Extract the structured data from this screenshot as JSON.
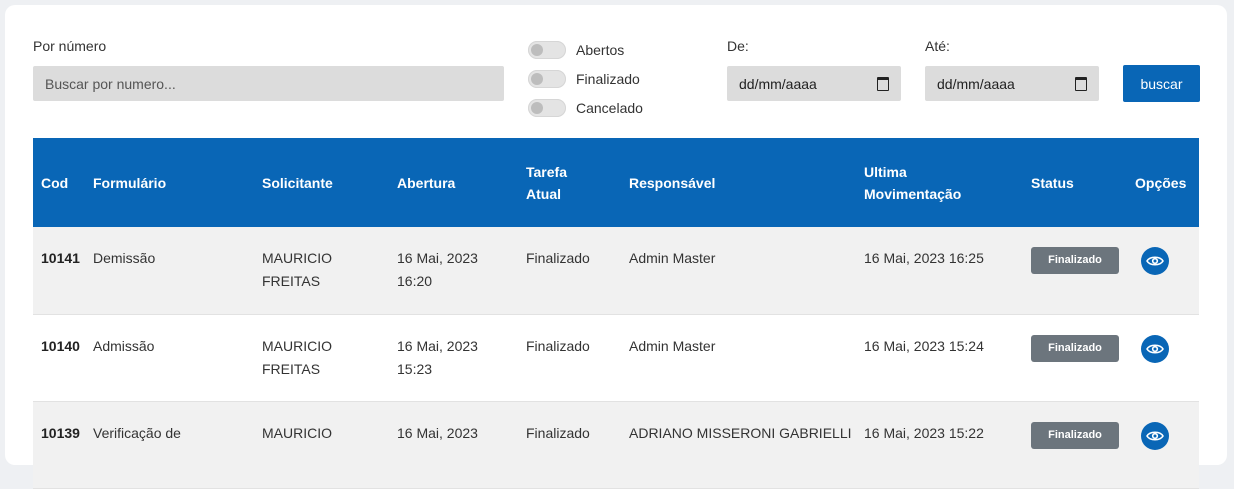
{
  "filters": {
    "number_label": "Por número",
    "search_placeholder": "Buscar por numero...",
    "toggles": [
      {
        "label": "Abertos",
        "checked": false
      },
      {
        "label": "Finalizado",
        "checked": false
      },
      {
        "label": "Cancelado",
        "checked": false
      }
    ],
    "from_label": "De:",
    "to_label": "Até:",
    "date_placeholder": "dd/mm/aaaa",
    "search_button": "buscar"
  },
  "table": {
    "headers": {
      "cod": "Cod",
      "formulario": "Formulário",
      "solicitante": "Solicitante",
      "abertura": "Abertura",
      "tarefa_1": "Tarefa",
      "tarefa_2": "Atual",
      "responsavel": "Responsável",
      "ultima_1": "Ultima",
      "ultima_2": "Movimentação",
      "status": "Status",
      "opcoes": "Opções"
    },
    "rows": [
      {
        "cod": "10141",
        "formulario": "Demissão",
        "solicitante_1": "MAURICIO",
        "solicitante_2": "FREITAS",
        "abertura_1": "16 Mai, 2023",
        "abertura_2": "16:20",
        "tarefa": "Finalizado",
        "responsavel": "Admin Master",
        "ultima": "16 Mai, 2023 16:25",
        "status": "Finalizado"
      },
      {
        "cod": "10140",
        "formulario": "Admissão",
        "solicitante_1": "MAURICIO",
        "solicitante_2": "FREITAS",
        "abertura_1": "16 Mai, 2023",
        "abertura_2": "15:23",
        "tarefa": "Finalizado",
        "responsavel": "Admin Master",
        "ultima": "16 Mai, 2023 15:24",
        "status": "Finalizado"
      },
      {
        "cod": "10139",
        "formulario": "Verificação de",
        "solicitante_1": "MAURICIO",
        "solicitante_2": "",
        "abertura_1": "16 Mai, 2023",
        "abertura_2": "",
        "tarefa": "Finalizado",
        "responsavel": "ADRIANO MISSERONI GABRIELLI",
        "ultima": "16 Mai, 2023 15:22",
        "status": "Finalizado"
      }
    ]
  },
  "colors": {
    "primary": "#0966b6",
    "badge_gray": "#6c757d",
    "row_shade": "#f1f1f1",
    "input_bg": "#dcdcdc"
  },
  "icons": {
    "view": "eye-icon",
    "calendar": "calendar-icon"
  }
}
